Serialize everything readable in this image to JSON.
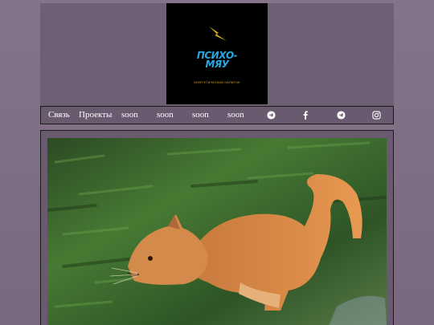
{
  "logo": {
    "brand_line1": "ПСИХО-",
    "brand_line2": "МЯУ",
    "tagline": "ЭНЕРГЕТИЧЕСКИЙ НАПИТОК"
  },
  "nav": {
    "items": [
      {
        "label": "Связь"
      },
      {
        "label": "Проекты"
      },
      {
        "label": "soon"
      },
      {
        "label": "soon"
      },
      {
        "label": "soon"
      },
      {
        "label": "soon"
      }
    ],
    "icons": [
      "telegram-icon",
      "facebook-icon",
      "telegram-icon",
      "instagram-icon"
    ]
  },
  "colors": {
    "background": "#7b6a80",
    "brand_blue": "#2aa7e0",
    "brand_orange": "#e0a21a"
  }
}
